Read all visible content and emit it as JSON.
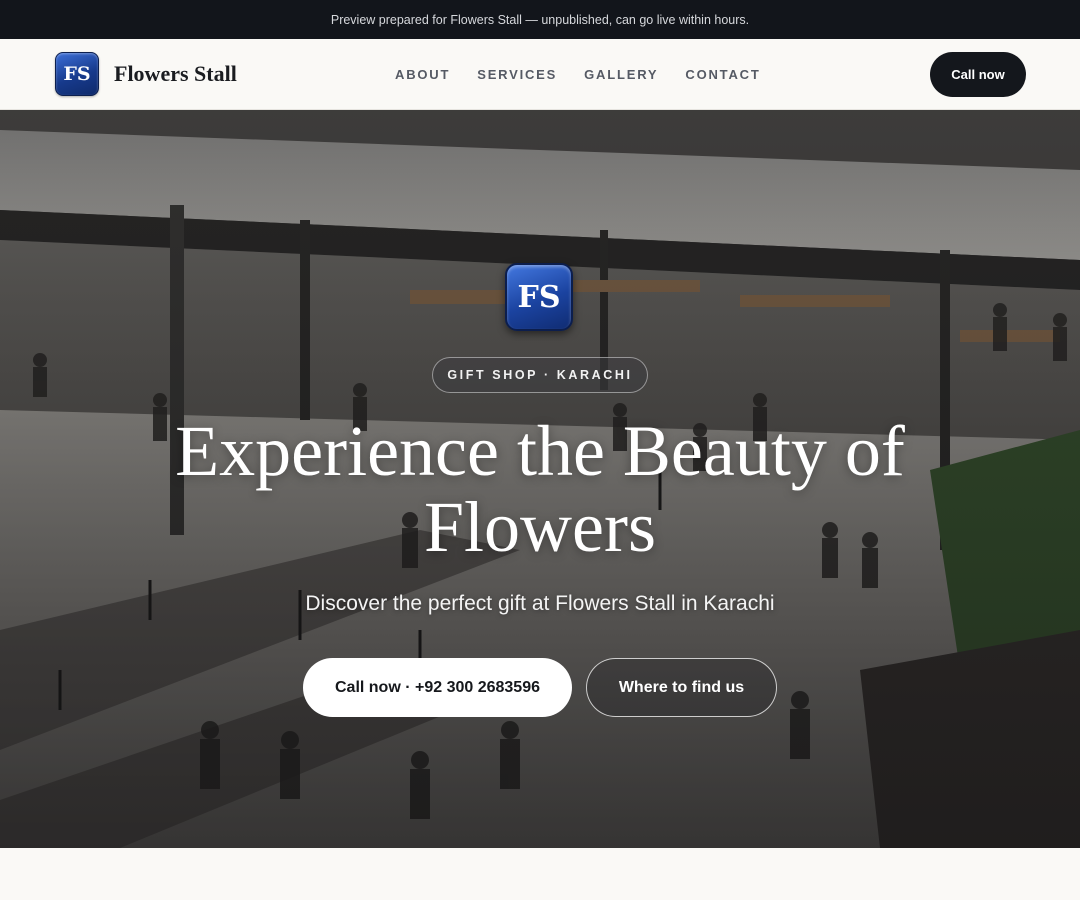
{
  "preview_banner": "Preview prepared for Flowers Stall — unpublished, can go live within hours.",
  "header": {
    "logo_initials": "FS",
    "brand_name": "Flowers Stall",
    "nav": [
      {
        "label": "ABOUT"
      },
      {
        "label": "SERVICES"
      },
      {
        "label": "GALLERY"
      },
      {
        "label": "CONTACT"
      }
    ],
    "cta_label": "Call now"
  },
  "hero": {
    "logo_initials": "FS",
    "tag": "GIFT SHOP · KARACHI",
    "title": "Experience the Beauty of Flowers",
    "subtitle": "Discover the perfect gift at Flowers Stall in Karachi",
    "primary_button": "Call now · +92 300 2683596",
    "secondary_button": "Where to find us"
  },
  "colors": {
    "brand_blue": "#1b43a0",
    "dark": "#14171c",
    "page_bg": "#faf9f6"
  }
}
